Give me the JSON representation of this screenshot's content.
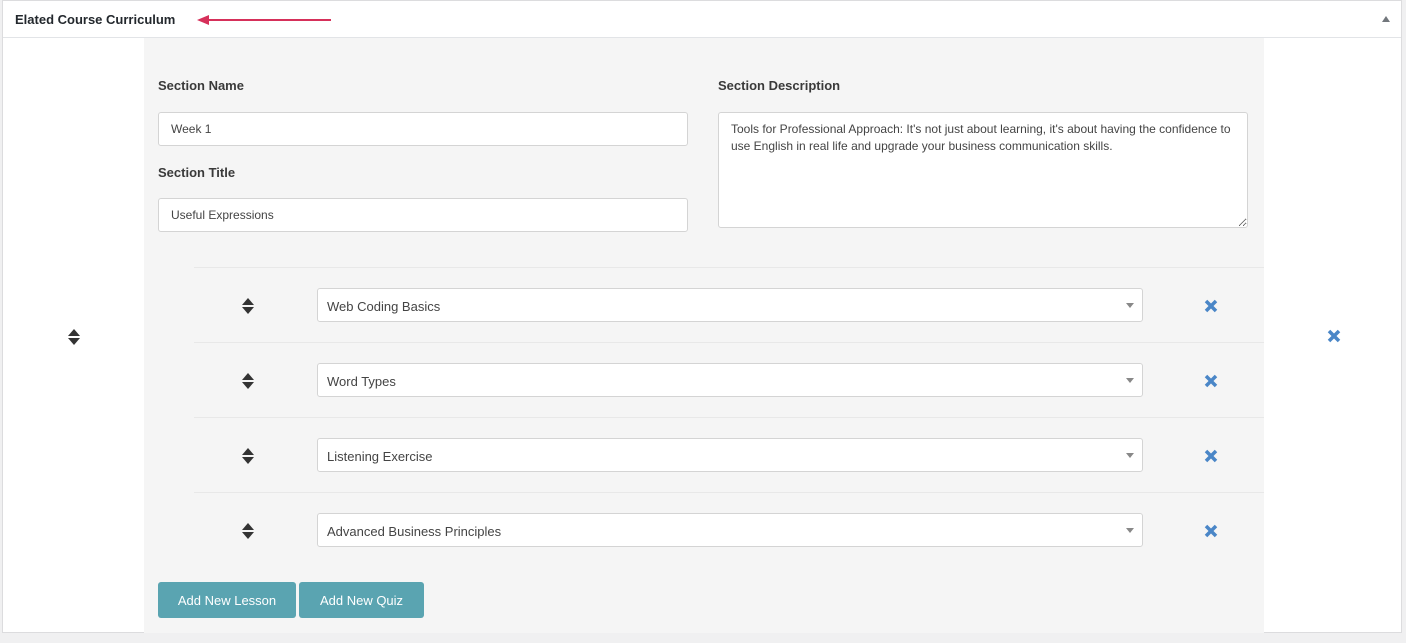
{
  "metabox": {
    "title": "Elated Course Curriculum"
  },
  "section": {
    "name_label": "Section Name",
    "name_value": "Week 1",
    "title_label": "Section Title",
    "title_value": "Useful Expressions",
    "description_label": "Section Description",
    "description_value": "Tools for Professional Approach: It's not just about learning, it's about having the confidence to use English in real life and upgrade your business communication skills."
  },
  "lessons": [
    {
      "label": "Web Coding Basics"
    },
    {
      "label": "Word Types"
    },
    {
      "label": "Listening Exercise"
    },
    {
      "label": "Advanced Business Principles"
    }
  ],
  "buttons": {
    "add_lesson": "Add New Lesson",
    "add_quiz": "Add New Quiz"
  },
  "colors": {
    "accent_button": "#5aa4b1",
    "remove_icon": "#4a86c7",
    "annotation_arrow": "#d6305a"
  },
  "icons": {
    "drag": "sort-arrows-icon",
    "remove": "close-icon",
    "collapse": "triangle-up-icon"
  }
}
